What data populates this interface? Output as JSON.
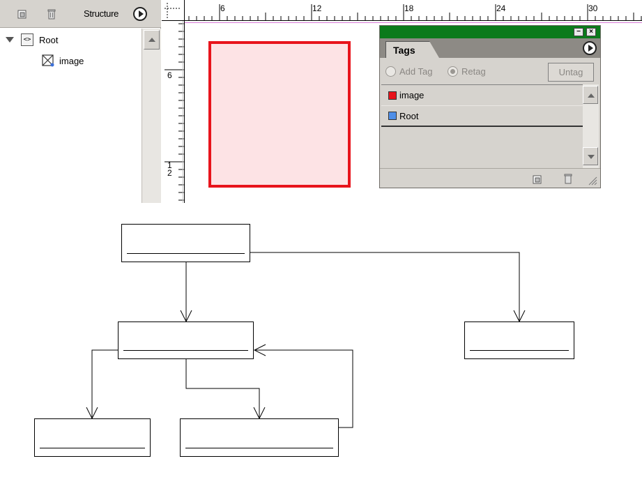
{
  "structure_panel": {
    "title": "Structure",
    "toolbar_icons": [
      "new-element-icon",
      "trash-icon",
      "panel-menu-icon"
    ],
    "tree": [
      {
        "label": "Root",
        "icon": "element-icon",
        "expanded": true
      },
      {
        "label": "image",
        "icon": "image-element-icon"
      }
    ]
  },
  "rulers": {
    "horizontal_labels": [
      "6",
      "12",
      "18",
      "24",
      "30"
    ],
    "vertical_labels": [
      "6",
      "1\n2"
    ]
  },
  "tags_panel": {
    "tab_label": "Tags",
    "options": {
      "add_tag": {
        "label": "Add Tag",
        "checked": false
      },
      "retag": {
        "label": "Retag",
        "checked": true
      }
    },
    "untag_label": "Untag",
    "tags": [
      {
        "name": "image",
        "color": "#e8141c"
      },
      {
        "name": "Root",
        "color": "#4f8fe8"
      }
    ],
    "titlebar_color": "#0b7a1b"
  },
  "frame": {
    "fill": "#fde3e5",
    "stroke": "#e8141c"
  },
  "diagram": {
    "nodes": [
      "box-top",
      "box-middle",
      "box-right",
      "box-bottom-left",
      "box-bottom-right"
    ]
  }
}
